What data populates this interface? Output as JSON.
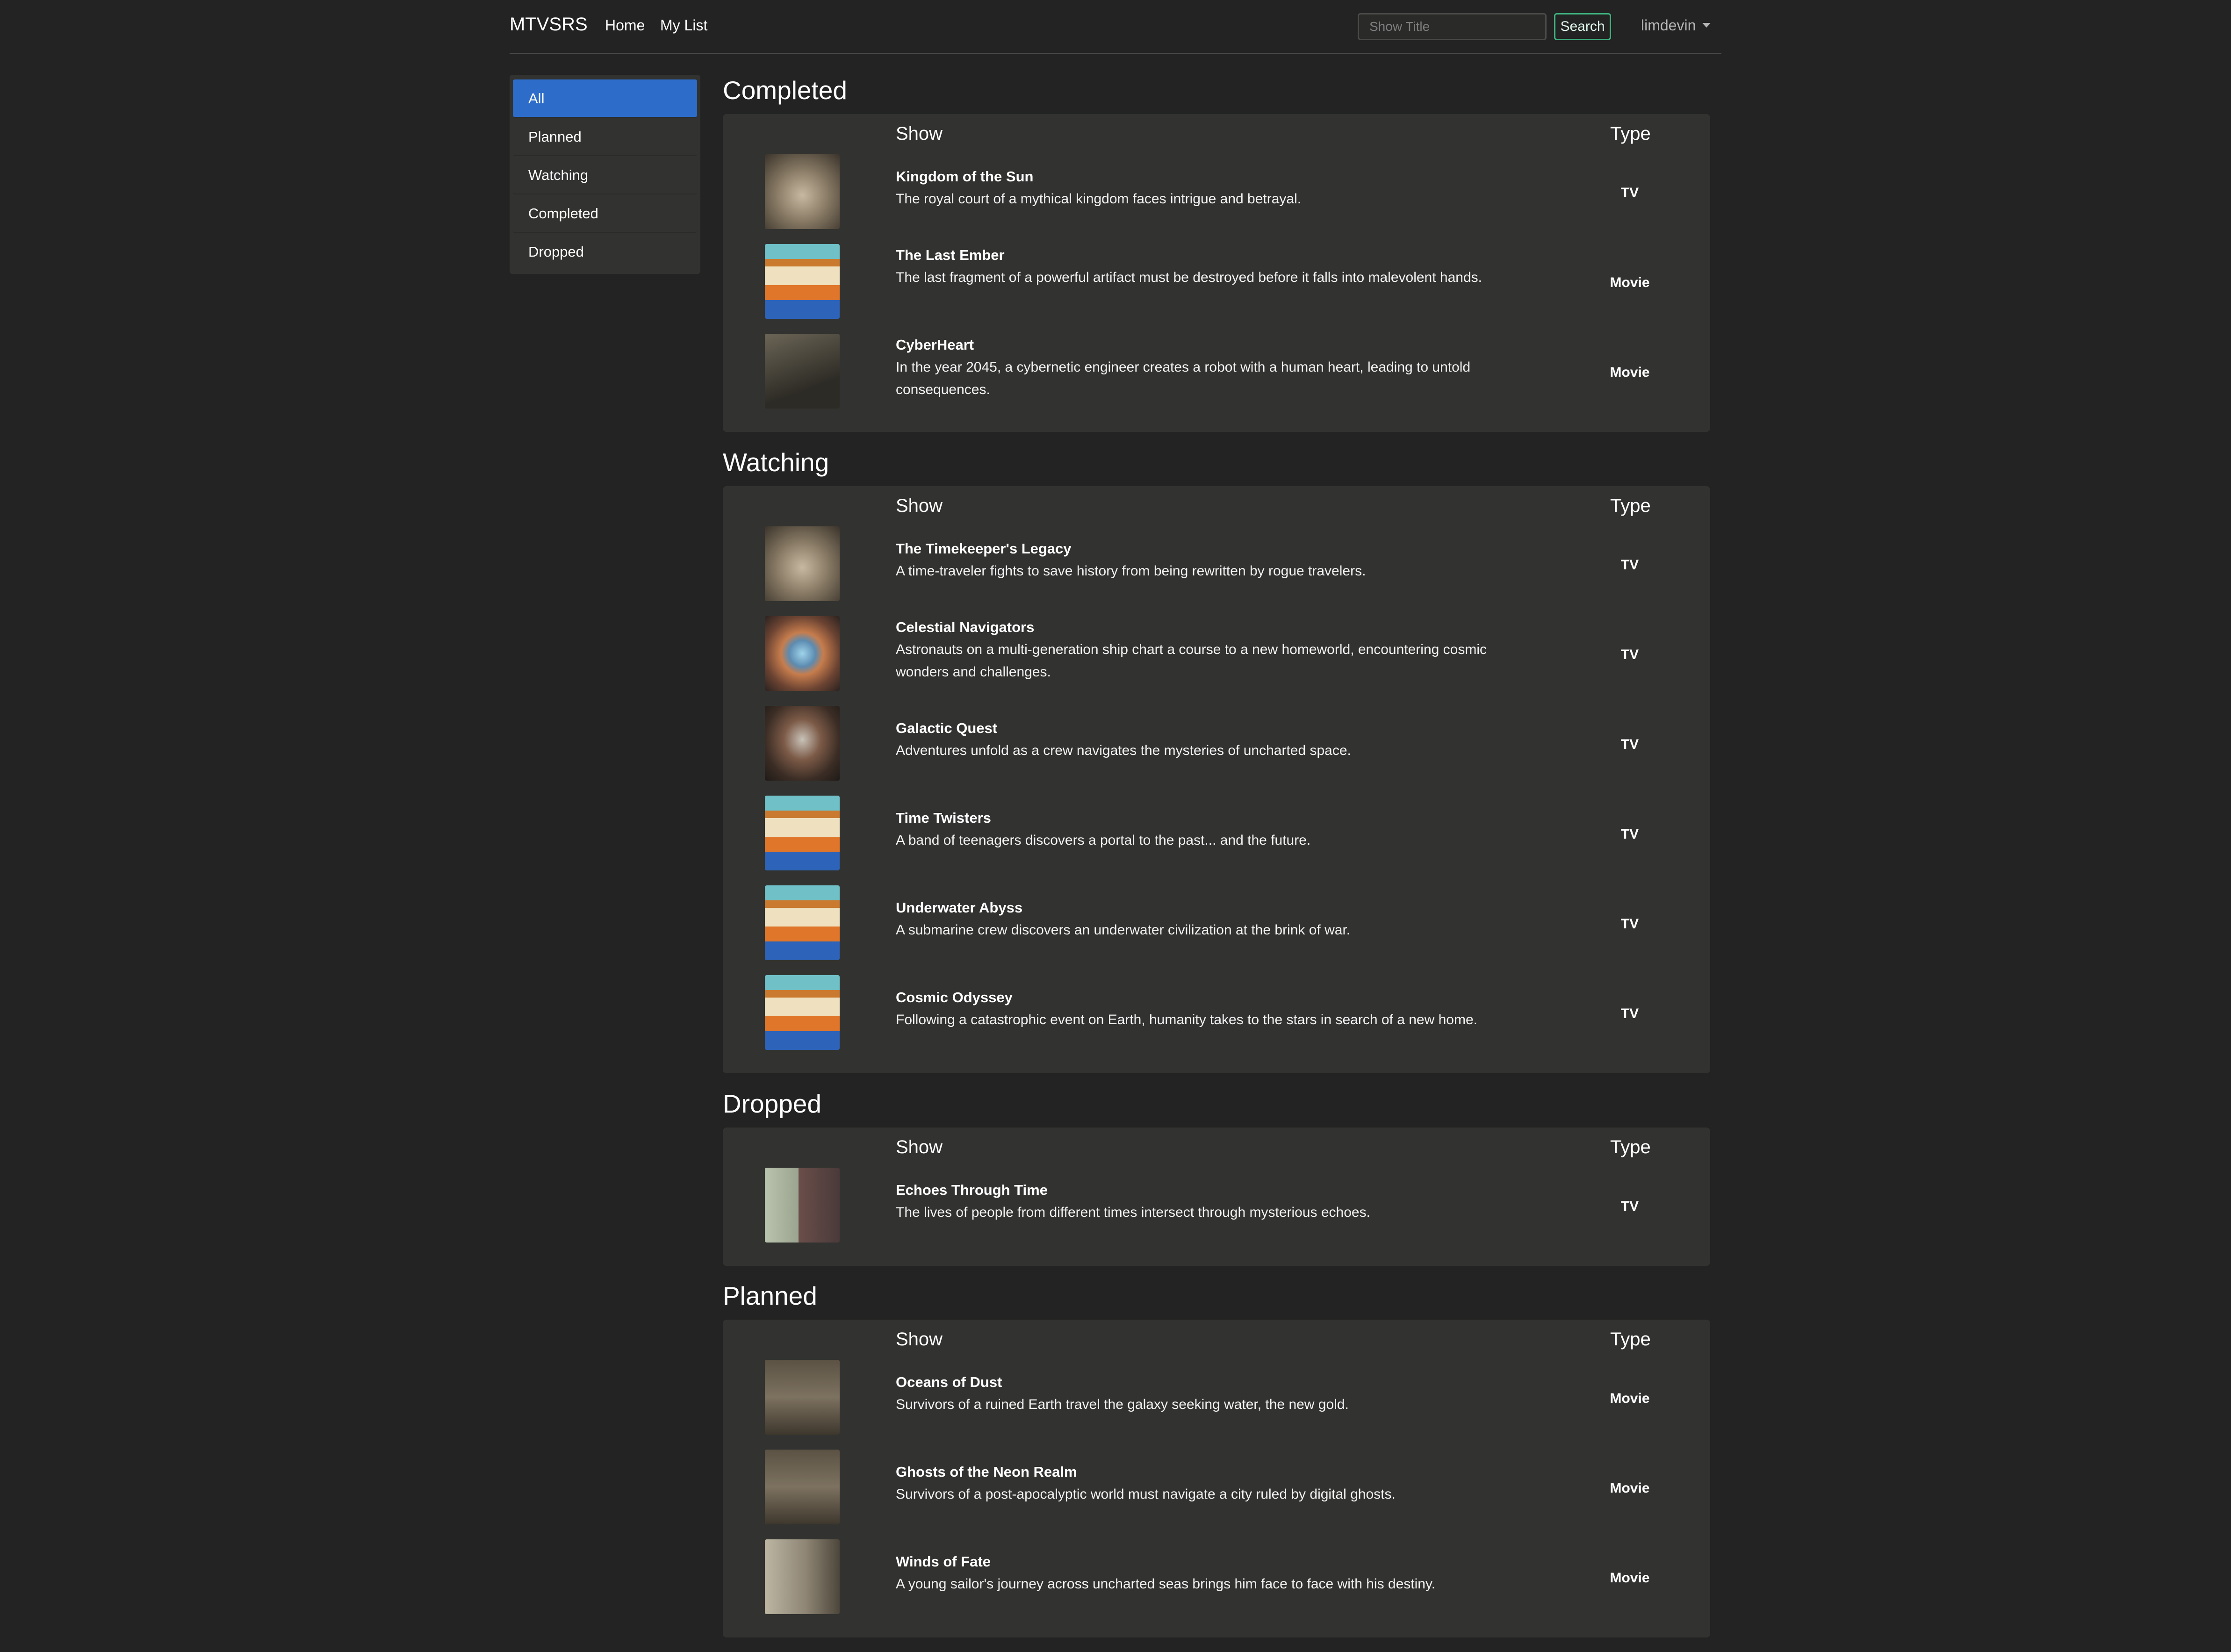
{
  "nav": {
    "brand": "MTVSRS",
    "links": [
      "Home",
      "My List"
    ],
    "search_placeholder": "Show Title",
    "search_button": "Search",
    "user": "limdevin"
  },
  "sidebar": {
    "items": [
      "All",
      "Planned",
      "Watching",
      "Completed",
      "Dropped"
    ],
    "active": "All"
  },
  "table_headers": {
    "show": "Show",
    "type": "Type"
  },
  "sections": [
    {
      "title": "Completed",
      "rows": [
        {
          "title": "Kingdom of the Sun",
          "description": "The royal court of a mythical kingdom faces intrigue and betrayal.",
          "type": "TV"
        },
        {
          "title": "The Last Ember",
          "description": "The last fragment of a powerful artifact must be destroyed before it falls into malevolent hands.",
          "type": "Movie"
        },
        {
          "title": "CyberHeart",
          "description": "In the year 2045, a cybernetic engineer creates a robot with a human heart, leading to untold consequences.",
          "type": "Movie"
        }
      ]
    },
    {
      "title": "Watching",
      "rows": [
        {
          "title": "The Timekeeper's Legacy",
          "description": "A time-traveler fights to save history from being rewritten by rogue travelers.",
          "type": "TV"
        },
        {
          "title": "Celestial Navigators",
          "description": "Astronauts on a multi-generation ship chart a course to a new homeworld, encountering cosmic wonders and challenges.",
          "type": "TV"
        },
        {
          "title": "Galactic Quest",
          "description": "Adventures unfold as a crew navigates the mysteries of uncharted space.",
          "type": "TV"
        },
        {
          "title": "Time Twisters",
          "description": "A band of teenagers discovers a portal to the past... and the future.",
          "type": "TV"
        },
        {
          "title": "Underwater Abyss",
          "description": "A submarine crew discovers an underwater civilization at the brink of war.",
          "type": "TV"
        },
        {
          "title": "Cosmic Odyssey",
          "description": "Following a catastrophic event on Earth, humanity takes to the stars in search of a new home.",
          "type": "TV"
        }
      ]
    },
    {
      "title": "Dropped",
      "rows": [
        {
          "title": "Echoes Through Time",
          "description": "The lives of people from different times intersect through mysterious echoes.",
          "type": "TV"
        }
      ]
    },
    {
      "title": "Planned",
      "rows": [
        {
          "title": "Oceans of Dust",
          "description": "Survivors of a ruined Earth travel the galaxy seeking water, the new gold.",
          "type": "Movie"
        },
        {
          "title": "Ghosts of the Neon Realm",
          "description": "Survivors of a post-apocalyptic world must navigate a city ruled by digital ghosts.",
          "type": "Movie"
        },
        {
          "title": "Winds of Fate",
          "description": "A young sailor's journey across uncharted seas brings him face to face with his destiny.",
          "type": "Movie"
        }
      ]
    }
  ],
  "colors": {
    "background": "#222322",
    "panel": "#323330",
    "active_nav": "#2d6cc8",
    "search_border": "#3fb27f"
  }
}
